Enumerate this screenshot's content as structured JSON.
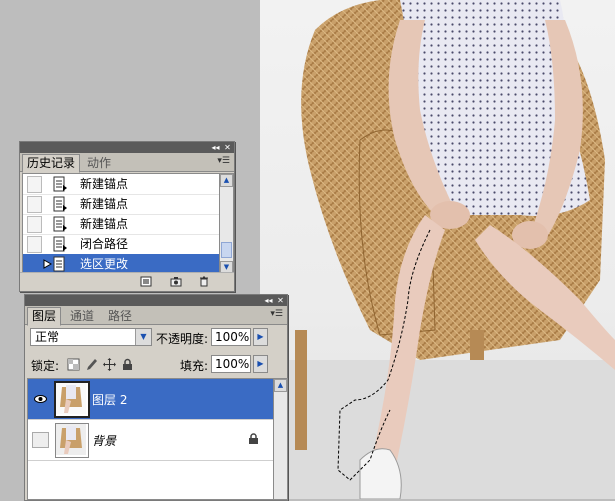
{
  "history_panel": {
    "tabs": [
      {
        "label": "历史记录",
        "active": true
      },
      {
        "label": "动作",
        "active": false
      }
    ],
    "items": [
      {
        "label": "新建锚点",
        "selected": false
      },
      {
        "label": "新建锚点",
        "selected": false
      },
      {
        "label": "新建锚点",
        "selected": false
      },
      {
        "label": "闭合路径",
        "selected": false
      },
      {
        "label": "选区更改",
        "selected": true
      }
    ]
  },
  "layers_panel": {
    "tabs": [
      {
        "label": "图层",
        "active": true
      },
      {
        "label": "通道",
        "active": false
      },
      {
        "label": "路径",
        "active": false
      }
    ],
    "blend_mode": "正常",
    "opacity_label": "不透明度:",
    "opacity_value": "100%",
    "lock_label": "锁定:",
    "fill_label": "填充:",
    "fill_value": "100%",
    "layers": [
      {
        "name": "图层 2",
        "selected": true,
        "visible": true,
        "locked": false
      },
      {
        "name": "背景",
        "selected": false,
        "visible": false,
        "locked": true
      }
    ]
  },
  "colors": {
    "selection": "#3a6bc4",
    "panel_bg": "#d4d0c8",
    "titlebar": "#5a5a5a"
  },
  "icons": [
    "collapse-icon",
    "close-icon",
    "panel-menu-icon",
    "history-state-icon",
    "eye-icon",
    "lock-icon",
    "new-document-icon",
    "camera-icon",
    "trash-icon",
    "brush-icon",
    "move-icon"
  ]
}
